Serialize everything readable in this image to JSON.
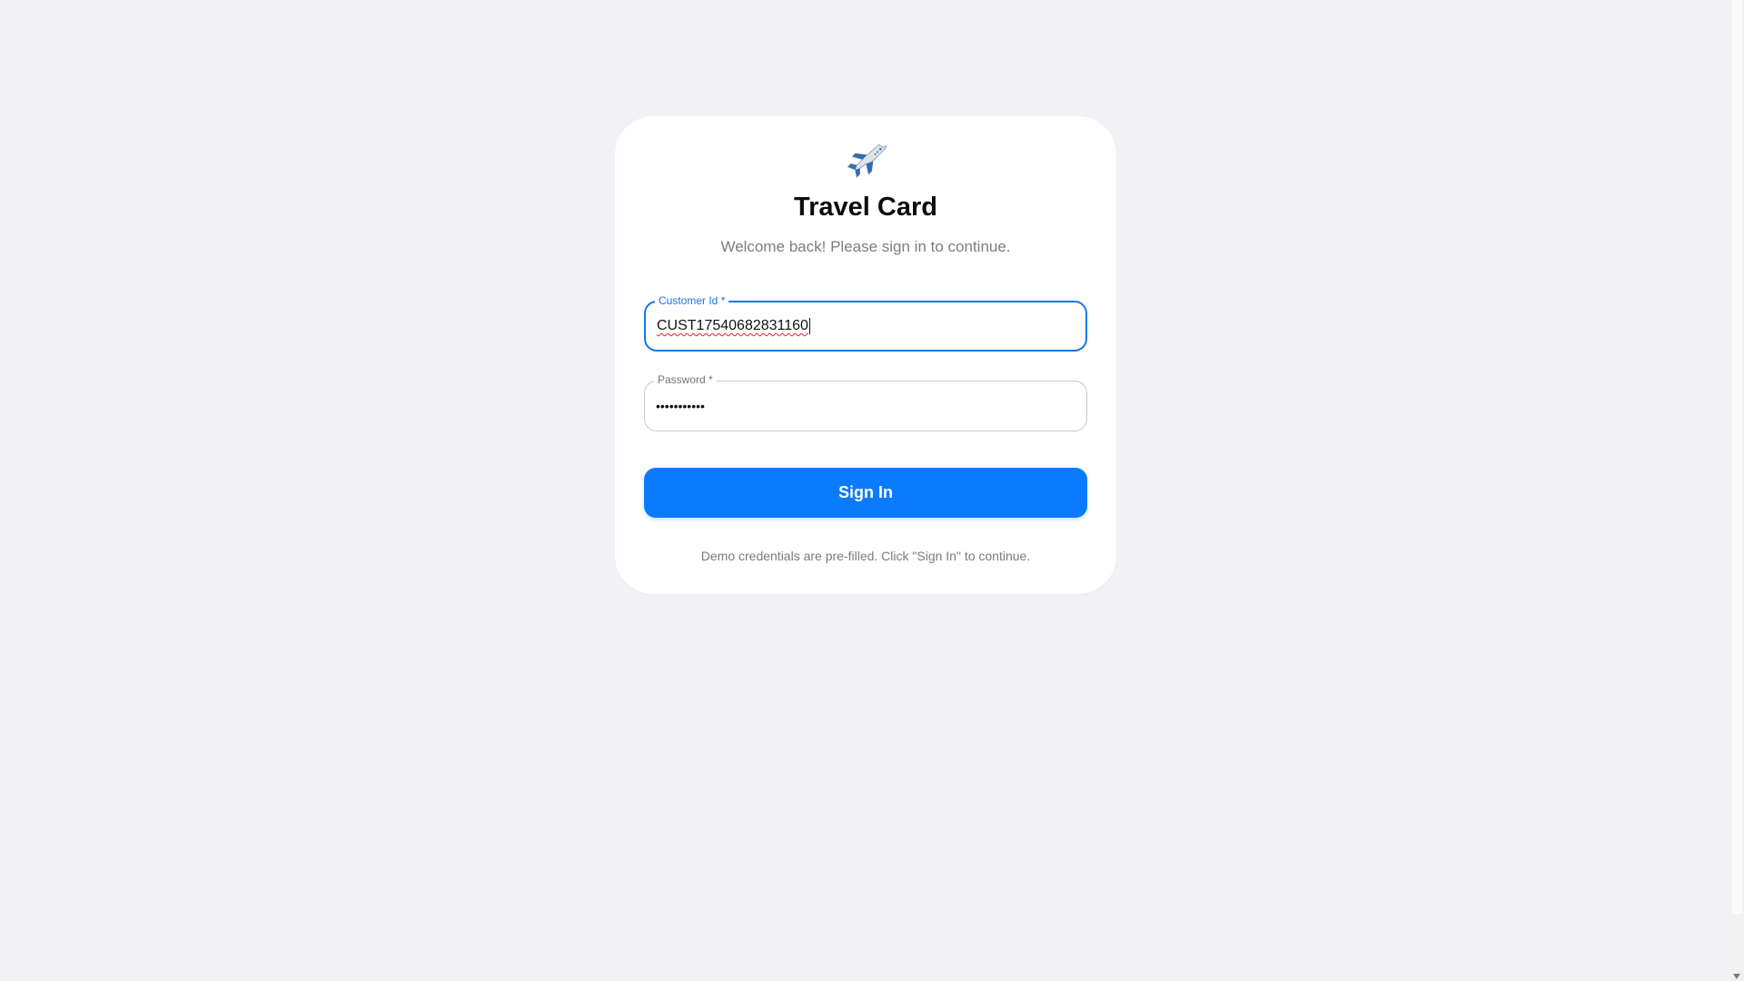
{
  "header": {
    "icon": "airplane-icon",
    "title": "Travel Card",
    "subtitle": "Welcome back! Please sign in to continue."
  },
  "form": {
    "customer_id": {
      "label": "Customer Id *",
      "value": "CUST17540682831160"
    },
    "password": {
      "label": "Password *",
      "value": "•••••••••••"
    },
    "submit_label": "Sign In",
    "hint": "Demo credentials are pre-filled. Click \"Sign In\" to continue."
  },
  "colors": {
    "accent": "#0a7bff",
    "focus_border": "#1a73e8",
    "background": "#f2f2f6"
  }
}
